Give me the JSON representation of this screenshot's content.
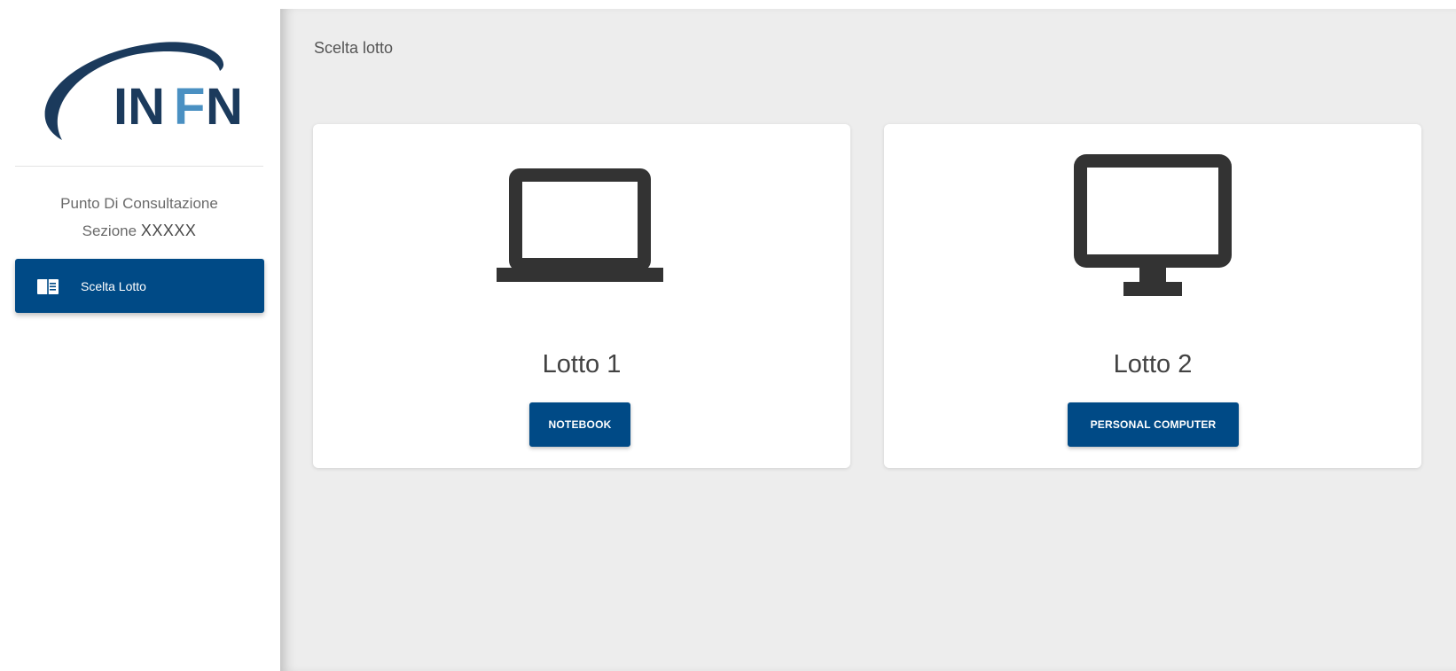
{
  "brand": {
    "logo_text": "INFN",
    "primary_color": "#004a86",
    "logo_dark_color": "#1b3a5c",
    "logo_accent_color": "#4a90c2"
  },
  "sidebar": {
    "consult_title": "Punto Di Consultazione",
    "section_prefix": "Sezione",
    "section_code": "XXXXX",
    "items": [
      {
        "label": "Scelta Lotto",
        "icon": "book-icon",
        "active": true
      }
    ]
  },
  "main": {
    "page_title": "Scelta lotto",
    "cards": [
      {
        "title": "Lotto 1",
        "button_label": "NOTEBOOK",
        "icon": "laptop-icon"
      },
      {
        "title": "Lotto 2",
        "button_label": "PERSONAL COMPUTER",
        "icon": "desktop-monitor-icon"
      }
    ]
  }
}
